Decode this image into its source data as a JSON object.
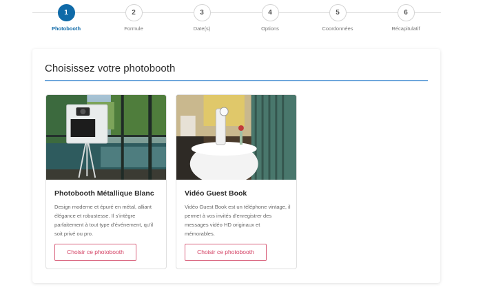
{
  "stepper": {
    "steps": [
      {
        "number": "1",
        "label": "Photobooth",
        "active": true
      },
      {
        "number": "2",
        "label": "Formule",
        "active": false
      },
      {
        "number": "3",
        "label": "Date(s)",
        "active": false
      },
      {
        "number": "4",
        "label": "Options",
        "active": false
      },
      {
        "number": "5",
        "label": "Coordonnées",
        "active": false
      },
      {
        "number": "6",
        "label": "Récapitulatif",
        "active": false
      }
    ]
  },
  "panel": {
    "title": "Choisissez votre photobooth",
    "cards": [
      {
        "title": "Photobooth Métallique Blanc",
        "description": "Design moderne et épuré en métal, alliant élégance et robustesse. Il s’intègre parfaitement à tout type d’événement, qu’il soit privé ou pro.",
        "button_label": "Choisir ce photobooth"
      },
      {
        "title": "Vidéo Guest Book",
        "description": "Vidéo Guest Book est un téléphone vintage, il permet à vos invités d’enregistrer des messages vidéo HD originaux et mémorables.",
        "button_label": "Choisir ce photobooth"
      }
    ]
  },
  "colors": {
    "accent": "#0f6aa8",
    "rule": "#6fa8dc",
    "button": "#d23c5f"
  }
}
